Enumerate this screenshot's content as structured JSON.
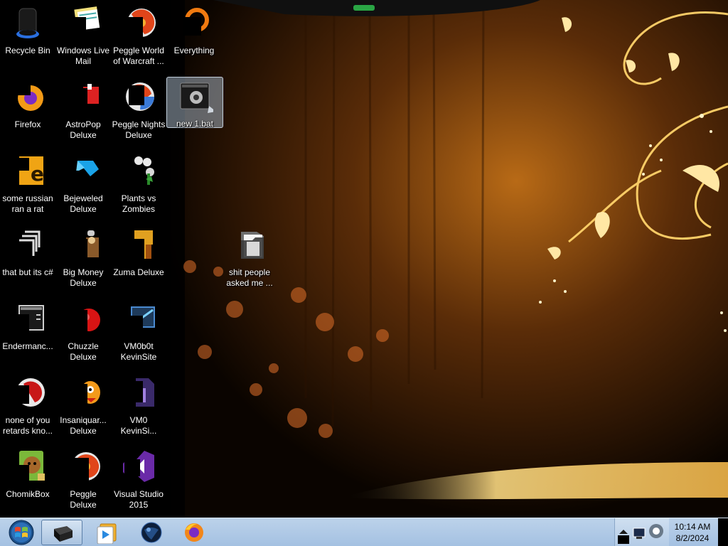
{
  "desktop": {
    "icons": [
      {
        "label": "Recycle Bin",
        "icon": "recycle-bin-icon"
      },
      {
        "label": "Windows Live\nMail",
        "icon": "mail-icon"
      },
      {
        "label": "Peggle World\nof Warcraft ...",
        "icon": "peggle-icon"
      },
      {
        "label": "Everything",
        "icon": "everything-search-icon"
      },
      {
        "label": "Firefox",
        "icon": "firefox-icon"
      },
      {
        "label": "AstroPop\nDeluxe",
        "icon": "astropop-icon"
      },
      {
        "label": "Peggle Nights\nDeluxe",
        "icon": "peggle-nights-icon"
      },
      {
        "label": "new 1.bat",
        "icon": "batch-file-icon"
      },
      {
        "label": "some russian\nran a rat",
        "icon": "java-icon"
      },
      {
        "label": "Bejeweled\nDeluxe",
        "icon": "bejeweled-icon"
      },
      {
        "label": "Plants vs\nZombies",
        "icon": "plants-vs-zombies-icon"
      },
      {
        "label": "that but its c#",
        "icon": "shortcut-stack-icon"
      },
      {
        "label": "Big Money\nDeluxe",
        "icon": "big-money-icon"
      },
      {
        "label": "Zuma Deluxe",
        "icon": "zuma-icon"
      },
      {
        "label": "shit people\nasked me ...",
        "icon": "folder-icon"
      },
      {
        "label": "Endermanc...",
        "icon": "console-app-icon"
      },
      {
        "label": "Chuzzle\nDeluxe",
        "icon": "chuzzle-icon"
      },
      {
        "label": "VM0b0t\nKevinSite",
        "icon": "vm-console-icon"
      },
      {
        "label": "none of you\nretards kno...",
        "icon": "red-app-icon"
      },
      {
        "label": "Insaniquar...\nDeluxe",
        "icon": "insaniquarium-icon"
      },
      {
        "label": "VM0\nKevinSi...",
        "icon": "vm-file-icon"
      },
      {
        "label": "ChomikBox",
        "icon": "chomikbox-icon"
      },
      {
        "label": "Peggle Deluxe",
        "icon": "peggle-deluxe-icon"
      },
      {
        "label": "Visual Studio\n2015",
        "icon": "visual-studio-icon"
      }
    ],
    "selected": "new 1.bat"
  },
  "taskbar": {
    "start": "start-orb-icon",
    "buttons": [
      {
        "name": "command-prompt",
        "icon": "command-prompt-icon",
        "active": true
      },
      {
        "name": "media-player",
        "icon": "media-player-icon",
        "active": false
      },
      {
        "name": "globe-app",
        "icon": "globe-icon",
        "active": false
      },
      {
        "name": "firefox",
        "icon": "firefox-icon",
        "active": false
      }
    ],
    "clock": {
      "time": "10:14 AM",
      "date": "8/2/2024"
    }
  },
  "colors": {
    "taskbar": "#a4c1e2",
    "label_text": "#ffffff",
    "wallpaper_glow": "#f5c24a"
  }
}
